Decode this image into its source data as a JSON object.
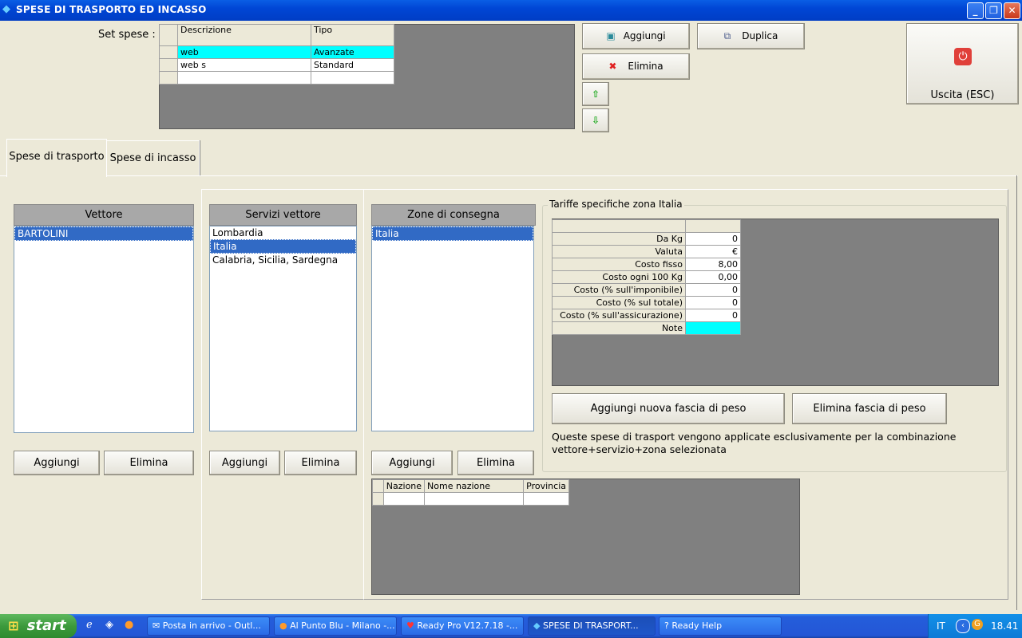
{
  "window": {
    "title": "SPESE DI TRASPORTO ED INCASSO"
  },
  "set_spese": {
    "label": "Set spese :",
    "columns": [
      "Descrizione",
      "Tipo"
    ],
    "rows": [
      {
        "descrizione": "web",
        "tipo": "Avanzate"
      },
      {
        "descrizione": "web s",
        "tipo": "Standard"
      }
    ]
  },
  "top_buttons": {
    "aggiungi": "Aggiungi",
    "duplica": "Duplica",
    "elimina": "Elimina",
    "uscita": "Uscita (ESC)"
  },
  "tabs": [
    "Spese di trasporto",
    "Spese di incasso"
  ],
  "vettore": {
    "header": "Vettore",
    "items": [
      "BARTOLINI"
    ],
    "add": "Aggiungi",
    "remove": "Elimina"
  },
  "servizi": {
    "header": "Servizi vettore",
    "items": [
      "Lombardia",
      "Italia",
      "Calabria, Sicilia, Sardegna"
    ],
    "add": "Aggiungi",
    "remove": "Elimina"
  },
  "zone": {
    "header": "Zone di consegna",
    "items": [
      "Italia"
    ],
    "add": "Aggiungi",
    "remove": "Elimina"
  },
  "nazioni": {
    "columns": [
      "Nazione",
      "Nome nazione",
      "Provincia"
    ]
  },
  "tariffe": {
    "title": "Tariffe specifiche zona Italia",
    "rows": [
      {
        "label": "Da Kg",
        "value": "0"
      },
      {
        "label": "Valuta",
        "value": "€"
      },
      {
        "label": "Costo fisso",
        "value": "8,00"
      },
      {
        "label": "Costo ogni 100 Kg",
        "value": "0,00"
      },
      {
        "label": "Costo (% sull'imponibile)",
        "value": "0"
      },
      {
        "label": "Costo (% sul totale)",
        "value": "0"
      },
      {
        "label": "Costo (% sull'assicurazione)",
        "value": "0"
      },
      {
        "label": "Note",
        "value": ""
      }
    ],
    "add_band": "Aggiungi nuova fascia di peso",
    "remove_band": "Elimina fascia di peso",
    "note": "Queste spese di trasport vengono applicate esclusivamente per la combinazione vettore+servizio+zona selezionata"
  },
  "taskbar": {
    "start": "start",
    "tasks": [
      "Posta in arrivo - Outl...",
      "Al Punto Blu - Milano -...",
      "Ready Pro V12.7.18 -...",
      "SPESE DI TRASPORT...",
      "Ready Help"
    ],
    "lang": "IT",
    "clock": "18.41"
  },
  "colors": {
    "selection": "#316ac5",
    "highlight_cell": "#00ffff",
    "titlebar": "#0046d5"
  }
}
